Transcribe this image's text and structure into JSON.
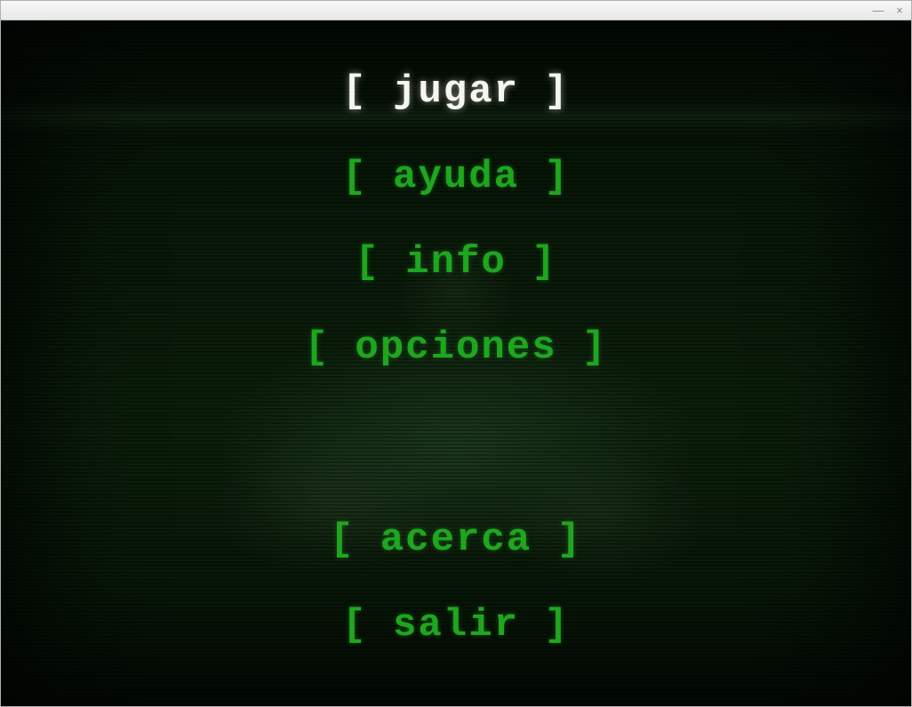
{
  "window": {
    "minimize_glyph": "—",
    "close_glyph": "×"
  },
  "menu": {
    "items": [
      {
        "label": "[ jugar ]",
        "selected": true
      },
      {
        "label": "[ ayuda ]",
        "selected": false
      },
      {
        "label": "[ info ]",
        "selected": false
      },
      {
        "label": "[ opciones ]",
        "selected": false
      }
    ],
    "footer_items": [
      {
        "label": "[ acerca ]",
        "selected": false
      },
      {
        "label": "[ salir ]",
        "selected": false
      }
    ]
  },
  "colors": {
    "menu_green": "#1fa61f",
    "menu_selected": "#f6f6f0",
    "background": "#0a1a0a"
  }
}
